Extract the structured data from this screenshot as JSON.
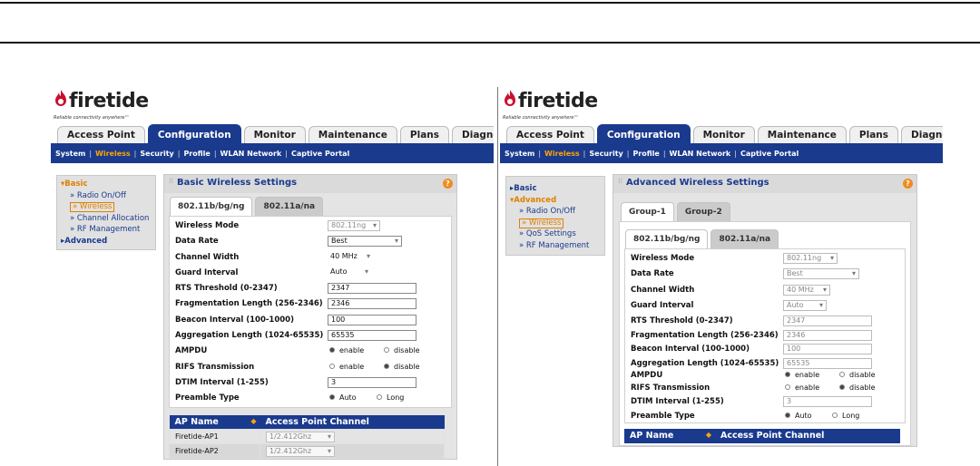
{
  "brand": {
    "name": "firetide",
    "tagline": "Reliable connectivity anywhere™"
  },
  "tabs": [
    "Access Point",
    "Configuration",
    "Monitor",
    "Maintenance",
    "Plans",
    "Diagnostics"
  ],
  "subnav": [
    "System",
    "Wireless",
    "Security",
    "Profile",
    "WLAN Network",
    "Captive Portal"
  ],
  "left": {
    "sidenav": {
      "basic": "Basic",
      "items": [
        "» Radio On/Off",
        "» Wireless",
        "» Channel Allocation",
        "» RF Management"
      ],
      "advanced": "Advanced"
    },
    "panel_title": "Basic Wireless Settings",
    "subtabs": [
      "802.11b/bg/ng",
      "802.11a/na"
    ],
    "fields": {
      "wireless_mode": {
        "label": "Wireless Mode",
        "value": "802.11ng"
      },
      "data_rate": {
        "label": "Data Rate",
        "value": "Best"
      },
      "channel_width": {
        "label": "Channel Width",
        "value": "40 MHz"
      },
      "guard_interval": {
        "label": "Guard Interval",
        "value": "Auto"
      },
      "rts": {
        "label": "RTS Threshold (0-2347)",
        "value": "2347"
      },
      "frag": {
        "label": "Fragmentation Length (256-2346)",
        "value": "2346"
      },
      "beacon": {
        "label": "Beacon Interval (100-1000)",
        "value": "100"
      },
      "aggregation": {
        "label": "Aggregation Length (1024-65535)",
        "value": "65535"
      },
      "ampdu": {
        "label": "AMPDU",
        "opt1": "enable",
        "opt2": "disable"
      },
      "rifs": {
        "label": "RIFS Transmission",
        "opt1": "enable",
        "opt2": "disable"
      },
      "dtim": {
        "label": "DTIM Interval (1-255)",
        "value": "3"
      },
      "preamble": {
        "label": "Preamble Type",
        "opt1": "Auto",
        "opt2": "Long"
      }
    },
    "table": {
      "col1": "AP Name",
      "col2": "Access Point Channel",
      "rows": [
        {
          "name": "Firetide-AP1",
          "channel": "1/2.412Ghz"
        },
        {
          "name": "Firetide-AP2",
          "channel": "1/2.412Ghz"
        }
      ]
    }
  },
  "right": {
    "sidenav": {
      "basic": "Basic",
      "advanced": "Advanced",
      "items": [
        "» Radio On/Off",
        "» Wireless",
        "» QoS Settings",
        "» RF Management"
      ]
    },
    "panel_title": "Advanced Wireless Settings",
    "group_tabs": [
      "Group-1",
      "Group-2"
    ],
    "subtabs": [
      "802.11b/bg/ng",
      "802.11a/na"
    ],
    "fields": {
      "wireless_mode": {
        "label": "Wireless Mode",
        "value": "802.11ng"
      },
      "data_rate": {
        "label": "Data Rate",
        "value": "Best"
      },
      "channel_width": {
        "label": "Channel Width",
        "value": "40 MHz"
      },
      "guard_interval": {
        "label": "Guard Interval",
        "value": "Auto"
      },
      "rts": {
        "label": "RTS Threshold (0-2347)",
        "value": "2347"
      },
      "frag": {
        "label": "Fragmentation Length (256-2346)",
        "value": "2346"
      },
      "beacon": {
        "label": "Beacon Interval (100-1000)",
        "value": "100"
      },
      "aggregation": {
        "label": "Aggregation Length (1024-65535)",
        "value": "65535"
      },
      "ampdu": {
        "label": "AMPDU",
        "opt1": "enable",
        "opt2": "disable"
      },
      "rifs": {
        "label": "RIFS Transmission",
        "opt1": "enable",
        "opt2": "disable"
      },
      "dtim": {
        "label": "DTIM Interval (1-255)",
        "value": "3"
      },
      "preamble": {
        "label": "Preamble Type",
        "opt1": "Auto",
        "opt2": "Long"
      }
    },
    "table": {
      "col1": "AP Name",
      "col2": "Access Point Channel"
    }
  }
}
